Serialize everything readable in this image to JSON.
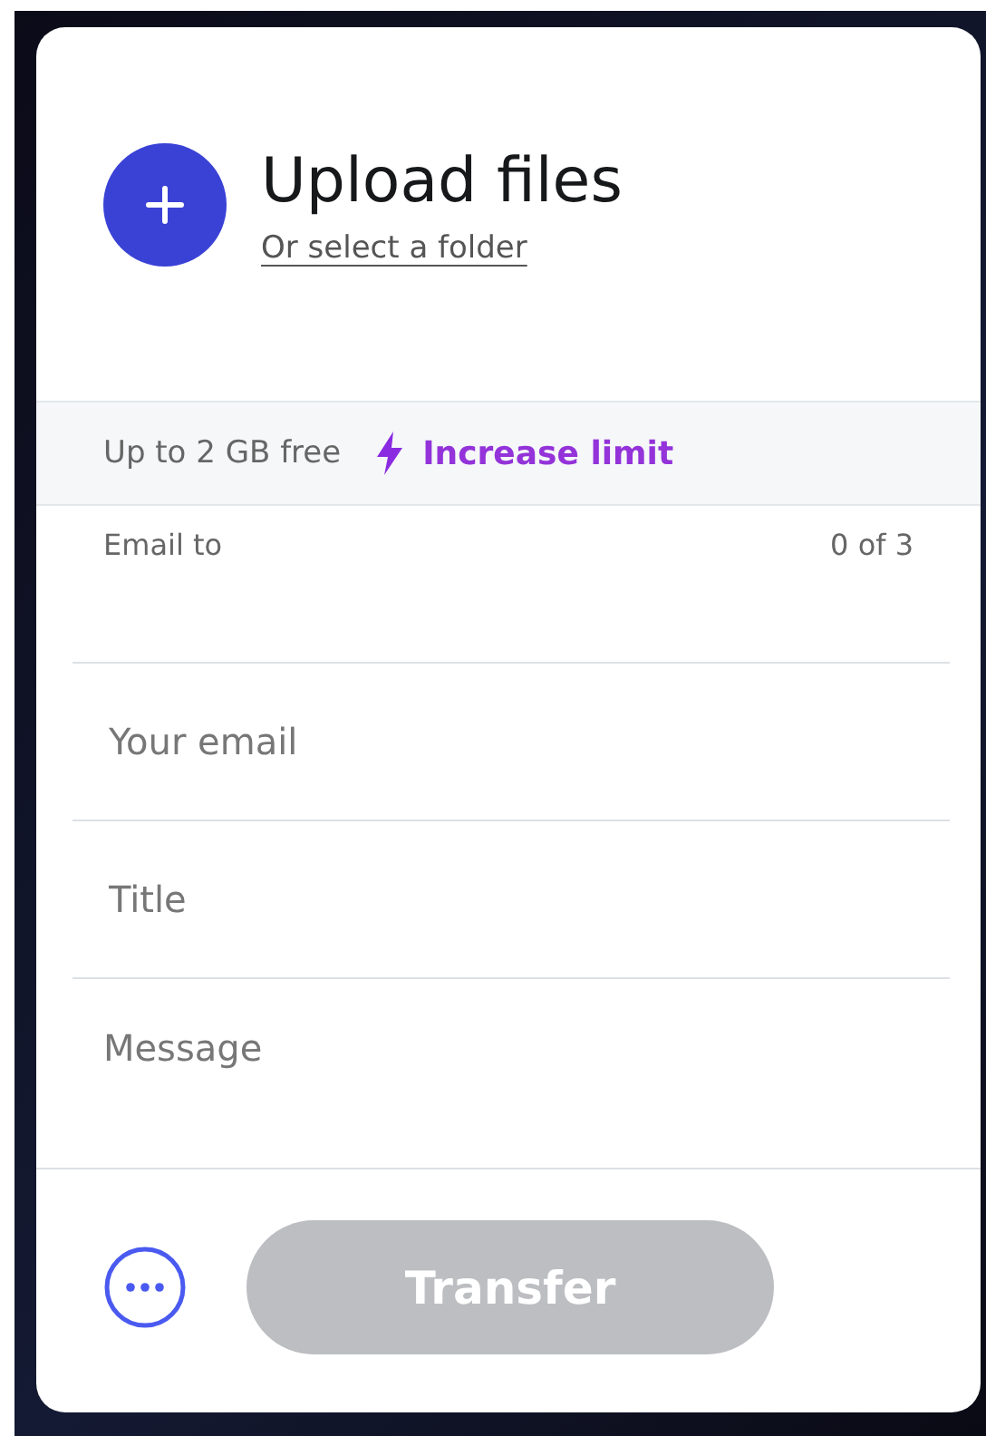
{
  "upload": {
    "title": "Upload files",
    "folder_link": "Or select a folder"
  },
  "limit": {
    "text": "Up to 2 GB free",
    "link": "Increase limit"
  },
  "recipients": {
    "label": "Email to",
    "count": "0 of 3"
  },
  "fields": [
    {
      "placeholder": "Your email",
      "kind": "input"
    },
    {
      "placeholder": "Title",
      "kind": "input"
    },
    {
      "placeholder": "Message",
      "kind": "textarea"
    }
  ],
  "transfer": {
    "label": "Transfer",
    "disabled": true
  }
}
